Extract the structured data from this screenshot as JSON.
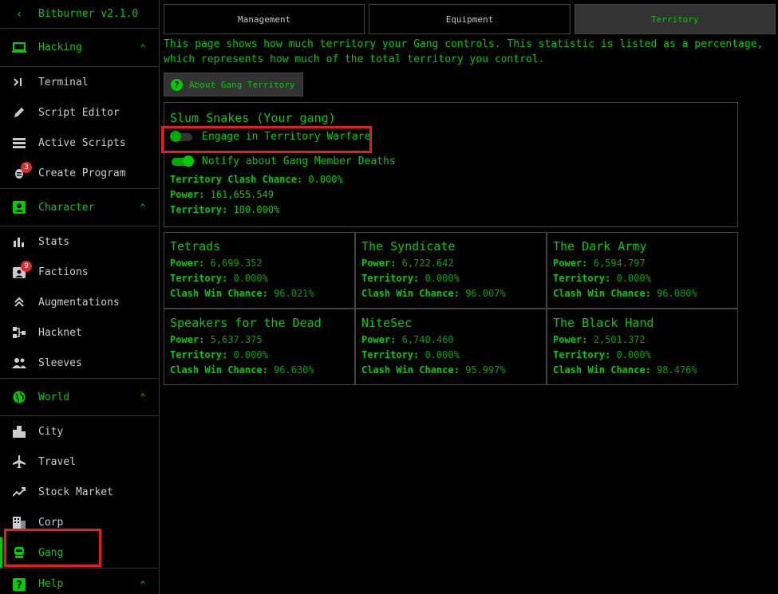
{
  "app": {
    "title": "Bitburner v2.1.0"
  },
  "sidebar": {
    "hacking": {
      "label": "Hacking",
      "items": [
        {
          "label": "Terminal",
          "icon": "terminal-icon"
        },
        {
          "label": "Script Editor",
          "icon": "pencil-icon"
        },
        {
          "label": "Active Scripts",
          "icon": "list-icon"
        },
        {
          "label": "Create Program",
          "icon": "bug-icon",
          "badge": "3"
        }
      ]
    },
    "character": {
      "label": "Character",
      "items": [
        {
          "label": "Stats",
          "icon": "bar-chart-icon"
        },
        {
          "label": "Factions",
          "icon": "contact-icon",
          "badge": "9"
        },
        {
          "label": "Augmentations",
          "icon": "double-chevron-up-icon"
        },
        {
          "label": "Hacknet",
          "icon": "network-icon"
        },
        {
          "label": "Sleeves",
          "icon": "people-icon"
        }
      ]
    },
    "world": {
      "label": "World",
      "items": [
        {
          "label": "City",
          "icon": "city-icon"
        },
        {
          "label": "Travel",
          "icon": "airplane-icon"
        },
        {
          "label": "Stock Market",
          "icon": "trending-up-icon"
        },
        {
          "label": "Corp",
          "icon": "building-icon"
        },
        {
          "label": "Gang",
          "icon": "gang-icon"
        }
      ]
    },
    "help": {
      "label": "Help"
    }
  },
  "tabs": [
    "Management",
    "Equipment",
    "Territory"
  ],
  "description": "This page shows how much territory your Gang controls. This statistic is listed as a percentage, which represents how much of the total territory you control.",
  "about_button": "About Gang Territory",
  "own_gang": {
    "name": "Slum Snakes (Your gang)",
    "engage_label": "Engage in Territory Warfare",
    "engage_on": false,
    "notify_label": "Notify about Gang Member Deaths",
    "notify_on": true,
    "clash_label": "Territory Clash Chance:",
    "clash_value": "0.000%",
    "power_label": "Power:",
    "power_value": "161,655.549",
    "territory_label": "Territory:",
    "territory_value": "100.000%"
  },
  "labels": {
    "power": "Power:",
    "territory": "Territory:",
    "clash": "Clash Win Chance:"
  },
  "gangs": [
    {
      "name": "Tetrads",
      "power": "6,699.352",
      "territory": "0.000%",
      "clash": "96.021%"
    },
    {
      "name": "The Syndicate",
      "power": "6,722.642",
      "territory": "0.000%",
      "clash": "96.007%"
    },
    {
      "name": "The Dark Army",
      "power": "6,594.797",
      "territory": "0.000%",
      "clash": "96.080%"
    },
    {
      "name": "Speakers for the Dead",
      "power": "5,637.375",
      "territory": "0.000%",
      "clash": "96.630%"
    },
    {
      "name": "NiteSec",
      "power": "6,740.460",
      "territory": "0.000%",
      "clash": "95.997%"
    },
    {
      "name": "The Black Hand",
      "power": "2,501.372",
      "territory": "0.000%",
      "clash": "98.476%"
    }
  ],
  "colors": {
    "accent": "#00cc00",
    "highlight": "#e02020",
    "background": "#000000"
  }
}
